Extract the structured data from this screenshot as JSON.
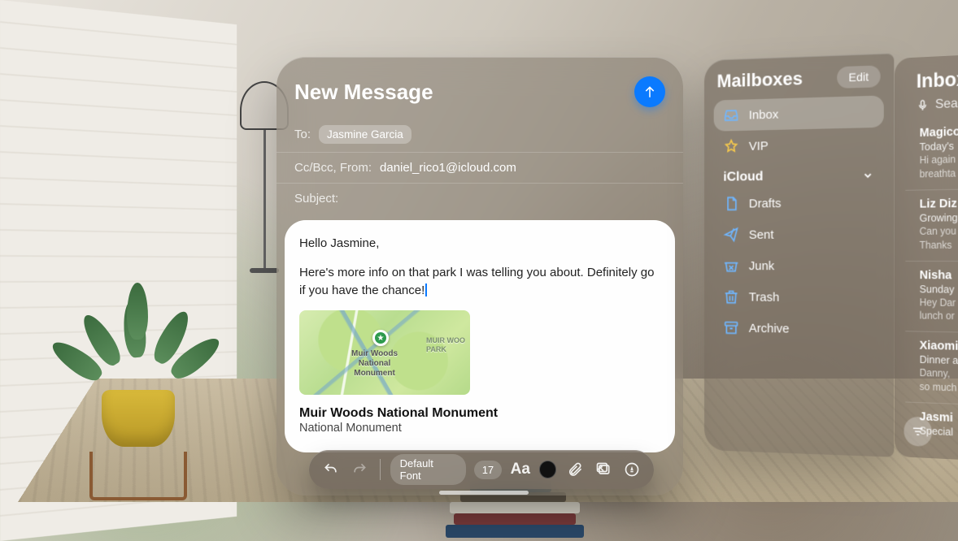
{
  "compose": {
    "title": "New Message",
    "to_label": "To:",
    "to_recipient": "Jasmine Garcia",
    "ccbcc_label": "Cc/Bcc, From:",
    "from_value": "daniel_rico1@icloud.com",
    "subject_label": "Subject:",
    "body_greeting": "Hello Jasmine,",
    "body_paragraph": "Here's more info on that park I was telling you about. Definitely go if you have the chance!",
    "map_label_main": "Muir Woods\nNational\nMonument",
    "map_label_side": "MUIR WOO\nPARK",
    "attachment_title": "Muir Woods National Monument",
    "attachment_subtitle": "National Monument"
  },
  "toolbar": {
    "font_name": "Default Font",
    "font_size": "17"
  },
  "mailboxes": {
    "title": "Mailboxes",
    "edit": "Edit",
    "inbox": "Inbox",
    "vip": "VIP",
    "section": "iCloud",
    "drafts": "Drafts",
    "sent": "Sent",
    "junk": "Junk",
    "trash": "Trash",
    "archive": "Archive"
  },
  "inbox_panel": {
    "title": "Inbox",
    "search_placeholder": "Search",
    "messages": [
      {
        "from": "Magico",
        "subject": "Today's",
        "preview": "Hi again\nbreathta"
      },
      {
        "from": "Liz Diz",
        "subject": "Growing",
        "preview": "Can you\nThanks "
      },
      {
        "from": "Nisha ",
        "subject": "Sunday",
        "preview": "Hey Dar\nlunch or"
      },
      {
        "from": "Xiaomi",
        "subject": "Dinner a",
        "preview": "Danny, \nso much"
      },
      {
        "from": "Jasmi",
        "subject": "Special ",
        "preview": ""
      }
    ]
  }
}
